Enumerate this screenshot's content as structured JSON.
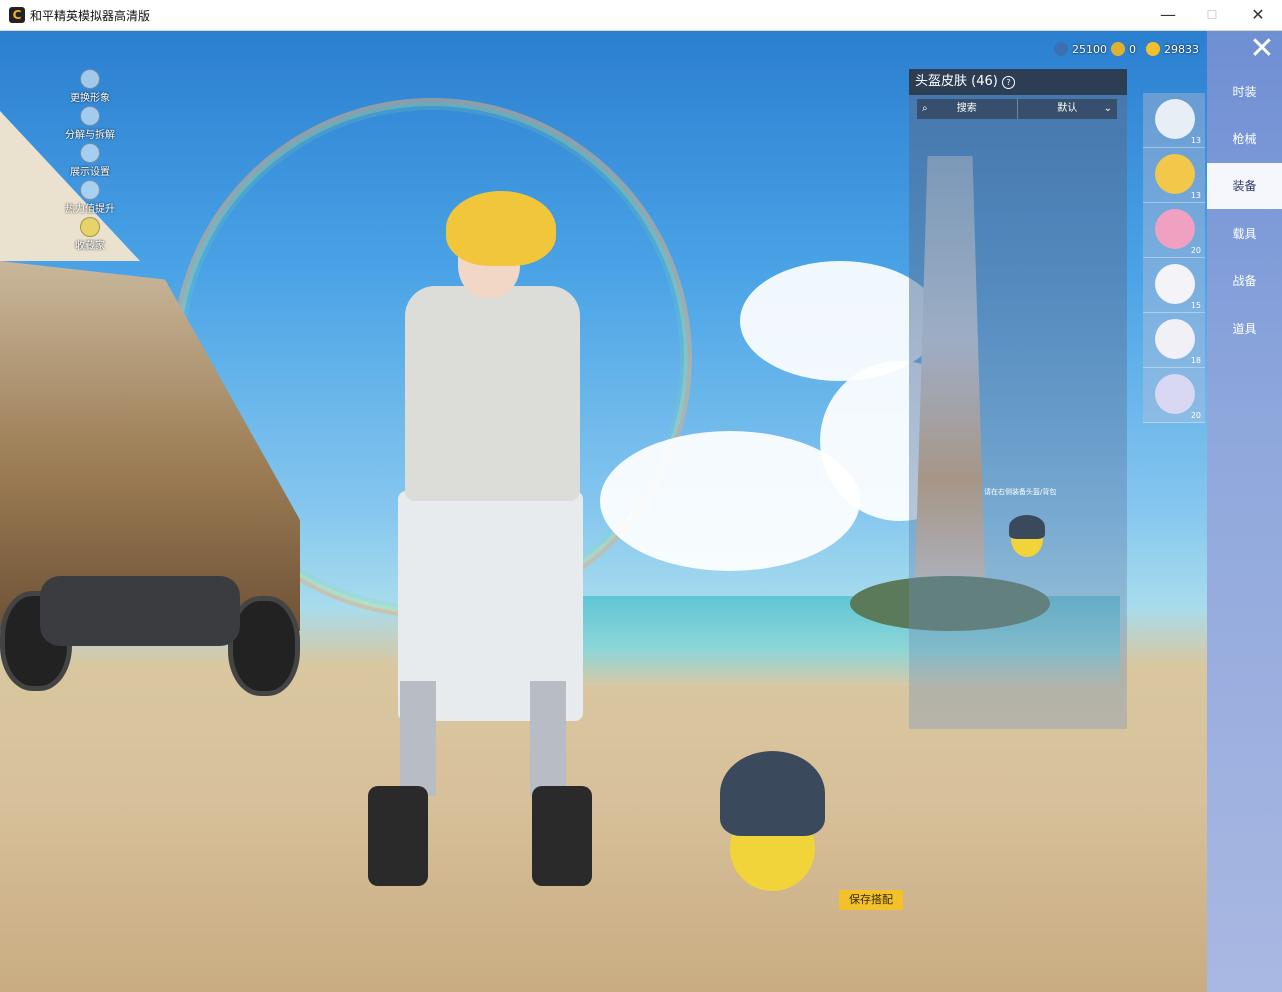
{
  "window": {
    "title": "和平精英模拟器高清版",
    "icon_letter": "C",
    "minimize": "—",
    "maximize": "☐",
    "close": "✕"
  },
  "left_menu": [
    {
      "label": "更换形象",
      "icon": "person-icon"
    },
    {
      "label": "分解与拆解",
      "icon": "plus-icon"
    },
    {
      "label": "展示设置",
      "icon": "eye-icon"
    },
    {
      "label": "热力值提升",
      "icon": "flame-icon"
    },
    {
      "label": "收藏家",
      "icon": "badge-icon"
    }
  ],
  "currency": [
    {
      "value": "25100",
      "color": "#3a6fb0"
    },
    {
      "value": "0",
      "color": "#e0b030"
    },
    {
      "value": "29833",
      "color": "#f2c12b"
    }
  ],
  "panel": {
    "title": "头盔皮肤 (46)",
    "help_icon": "?",
    "search_placeholder": "搜索",
    "sort_label": "默认",
    "hint": "请在右侧装备头盔/背包"
  },
  "items": [
    {
      "num": "13",
      "color": "#e8eef5"
    },
    {
      "num": "13",
      "color": "#f2c84a"
    },
    {
      "num": "20",
      "color": "#f0a0c0"
    },
    {
      "num": "15",
      "color": "#f4f4f8"
    },
    {
      "num": "18",
      "color": "#f0f0f6"
    },
    {
      "num": "20",
      "color": "#d8d8f2"
    }
  ],
  "categories": [
    {
      "label": "时装",
      "active": false
    },
    {
      "label": "枪械",
      "active": false
    },
    {
      "label": "装备",
      "active": true
    },
    {
      "label": "载具",
      "active": false
    },
    {
      "label": "战备",
      "active": false
    },
    {
      "label": "道具",
      "active": false
    }
  ],
  "close_symbol": "✕",
  "save_button": "保存搭配"
}
